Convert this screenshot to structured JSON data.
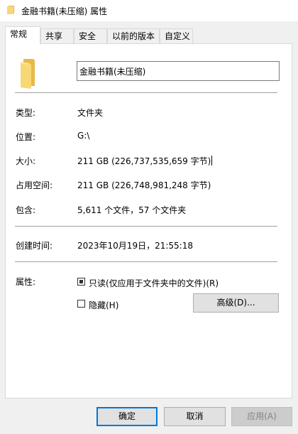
{
  "window": {
    "title": "金融书籍(未压缩) 属性",
    "icon": "folder-icon"
  },
  "tabs": [
    "常规",
    "共享",
    "安全",
    "以前的版本",
    "自定义"
  ],
  "general": {
    "name": "金融书籍(未压缩)",
    "type": {
      "label": "类型:",
      "value": "文件夹"
    },
    "location": {
      "label": "位置:",
      "value": "G:\\"
    },
    "size": {
      "label": "大小:",
      "value": "211 GB (226,737,535,659 字节)"
    },
    "size_on_disk": {
      "label": "占用空间:",
      "value": "211 GB (226,748,981,248 字节)"
    },
    "contains": {
      "label": "包含:",
      "value": "5,611 个文件，57 个文件夹"
    },
    "created": {
      "label": "创建时间:",
      "value": "2023年10月19日，21:55:18"
    },
    "attributes": {
      "label": "属性:",
      "readonly_label": "只读(仅应用于文件夹中的文件)(R)",
      "readonly_checked": true,
      "hidden_label": "隐藏(H)",
      "hidden_checked": false,
      "advanced_label": "高级(D)..."
    }
  },
  "buttons": {
    "ok": "确定",
    "cancel": "取消",
    "apply": "应用(A)"
  },
  "colors": {
    "folder_yellow": "#f8d775",
    "folder_shade": "#e8b84a",
    "accent": "#0078d7"
  }
}
